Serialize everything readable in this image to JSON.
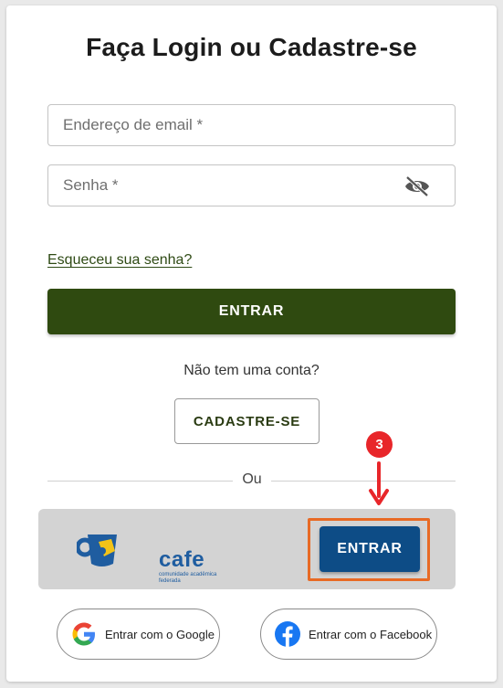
{
  "form": {
    "title": "Faça Login ou Cadastre-se",
    "email_placeholder": "Endereço de email *",
    "password_placeholder": "Senha *",
    "forgot_password": "Esqueceu sua senha?",
    "login_button": "ENTRAR",
    "no_account_text": "Não tem uma conta?",
    "signup_button": "CADASTRE-SE",
    "divider_text": "Ou"
  },
  "cafe": {
    "logo_word": "cafe",
    "logo_subtitle": "comunidade acadêmica federada",
    "login_button": "ENTRAR"
  },
  "annotation": {
    "step_number": "3"
  },
  "social": {
    "google_label": "Entrar com o Google",
    "facebook_label": "Entrar com o Facebook"
  },
  "colors": {
    "primary_green": "#2f4a10",
    "cafe_blue": "#0d4c86",
    "highlight_orange": "#e86a25",
    "step_red": "#e8262a"
  },
  "icons": {
    "password_toggle": "eye-off-icon",
    "google": "google-icon",
    "facebook": "facebook-icon",
    "cafe": "cafe-cup-icon"
  }
}
